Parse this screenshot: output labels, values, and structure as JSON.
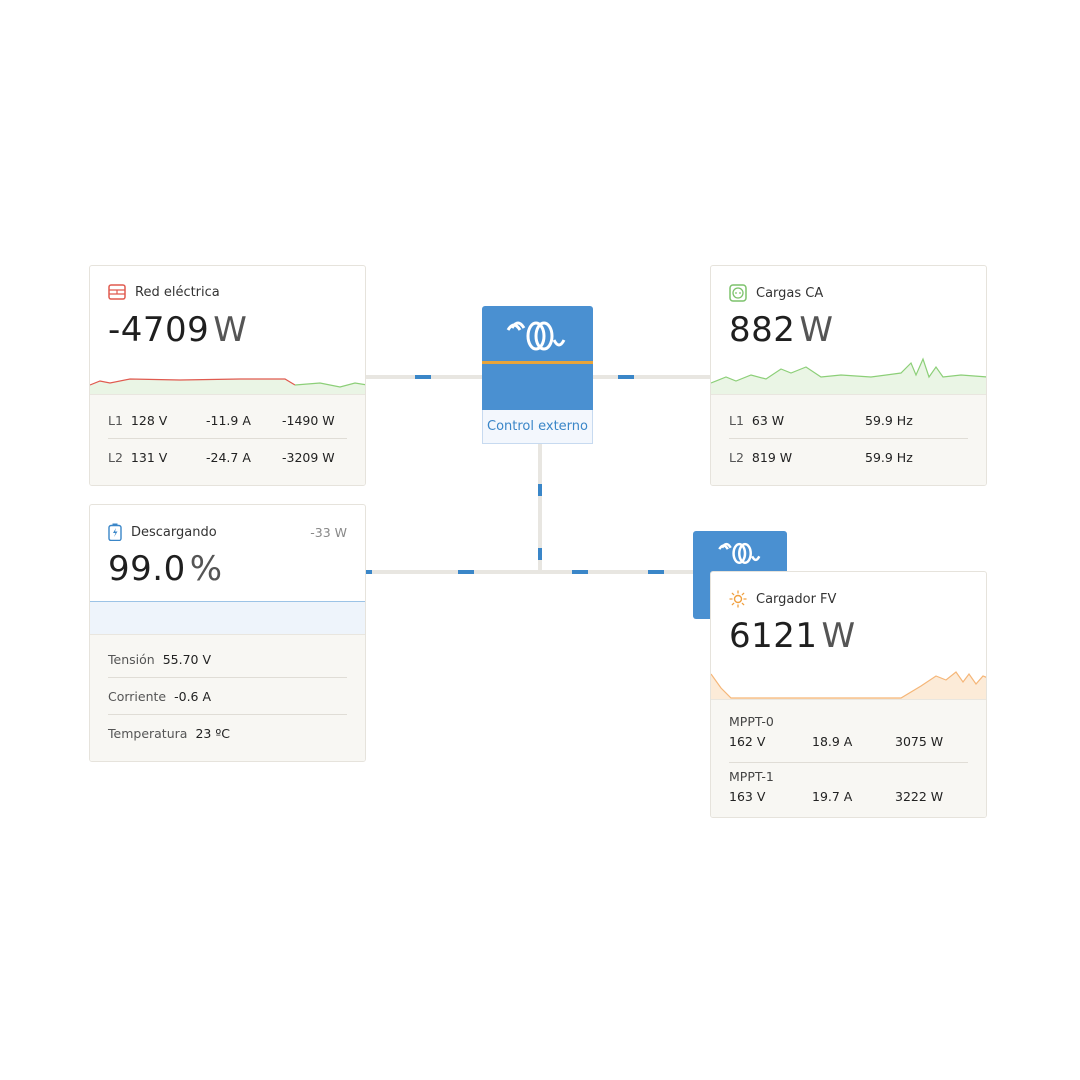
{
  "grid": {
    "title": "Red eléctrica",
    "value": "-4709",
    "unit": "W",
    "phases": [
      {
        "label": "L1",
        "voltage": "128 V",
        "current": "-11.9 A",
        "power": "-1490 W"
      },
      {
        "label": "L2",
        "voltage": "131 V",
        "current": "-24.7 A",
        "power": "-3209 W"
      }
    ]
  },
  "loads": {
    "title": "Cargas CA",
    "value": "882",
    "unit": "W",
    "phases": [
      {
        "label": "L1",
        "power": "63 W",
        "freq": "59.9 Hz"
      },
      {
        "label": "L2",
        "power": "819 W",
        "freq": "59.9 Hz"
      }
    ]
  },
  "inverter": {
    "mode_label": "Control externo"
  },
  "battery": {
    "title": "Descargando",
    "power": "-33 W",
    "value": "99.0",
    "unit": "%",
    "soc_fraction": 0.99,
    "rows": [
      {
        "label": "Tensión",
        "value": "55.70 V"
      },
      {
        "label": "Corriente",
        "value": "-0.6 A"
      },
      {
        "label": "Temperatura",
        "value": "23 ºC"
      }
    ]
  },
  "pv": {
    "title": "Cargador FV",
    "value": "6121",
    "unit": "W",
    "trackers": [
      {
        "name": "MPPT-0",
        "voltage": "162 V",
        "current": "18.9 A",
        "power": "3075 W"
      },
      {
        "name": "MPPT-1",
        "voltage": "163 V",
        "current": "19.7 A",
        "power": "3222 W"
      }
    ]
  },
  "colors": {
    "accent": "#4a90d1",
    "grid": "#e05a4f",
    "loads": "#7cc26b",
    "pv": "#f0a040",
    "battery": "#3a86c8"
  }
}
